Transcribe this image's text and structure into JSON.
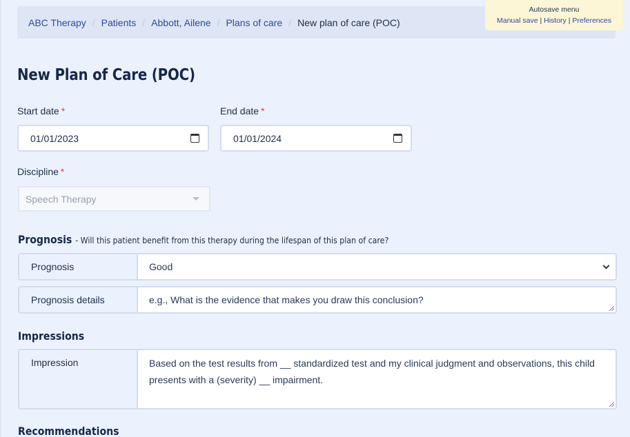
{
  "breadcrumb": [
    {
      "label": "ABC Therapy",
      "link": true
    },
    {
      "label": "Patients",
      "link": true
    },
    {
      "label": "Abbott, Ailene",
      "link": true
    },
    {
      "label": "Plans of care",
      "link": true
    },
    {
      "label": "New plan of care (POC)",
      "link": false
    }
  ],
  "breadcrumb_separator": "/",
  "autosave": {
    "title": "Autosave menu",
    "links": [
      "Manual save",
      "History",
      "Preferences"
    ],
    "separator": "|"
  },
  "page_title": "New Plan of Care (POC)",
  "form": {
    "start_date": {
      "label": "Start date",
      "required_mark": "*",
      "value": "01/01/2023"
    },
    "end_date": {
      "label": "End date",
      "required_mark": "*",
      "value": "01/01/2024"
    },
    "discipline": {
      "label": "Discipline",
      "required_mark": "*",
      "value": "Speech Therapy",
      "disabled": true
    }
  },
  "prognosis": {
    "heading": "Prognosis",
    "subheading": "- Will this patient benefit from this therapy during the lifespan of this plan of care?",
    "rows": [
      {
        "label": "Prognosis",
        "type": "select",
        "value": "Good"
      },
      {
        "label": "Prognosis details",
        "type": "textarea",
        "placeholder": "e.g., What is the evidence that makes you draw this conclusion?"
      }
    ]
  },
  "impressions": {
    "heading": "Impressions",
    "rows": [
      {
        "label": "Impression",
        "type": "textarea",
        "value": "Based on the test results from __ standardized test and my clinical judgment and observations, this child presents with a (severity) __ impairment."
      }
    ]
  },
  "recommendations": {
    "heading": "Recommendations"
  },
  "colors": {
    "background": "#ecf2fd",
    "breadcrumb_bg": "#dee6f5",
    "link": "#2c4a9f",
    "autosave_bg": "#fcf6d6",
    "required": "#e33d4f",
    "heading": "#16284a"
  }
}
